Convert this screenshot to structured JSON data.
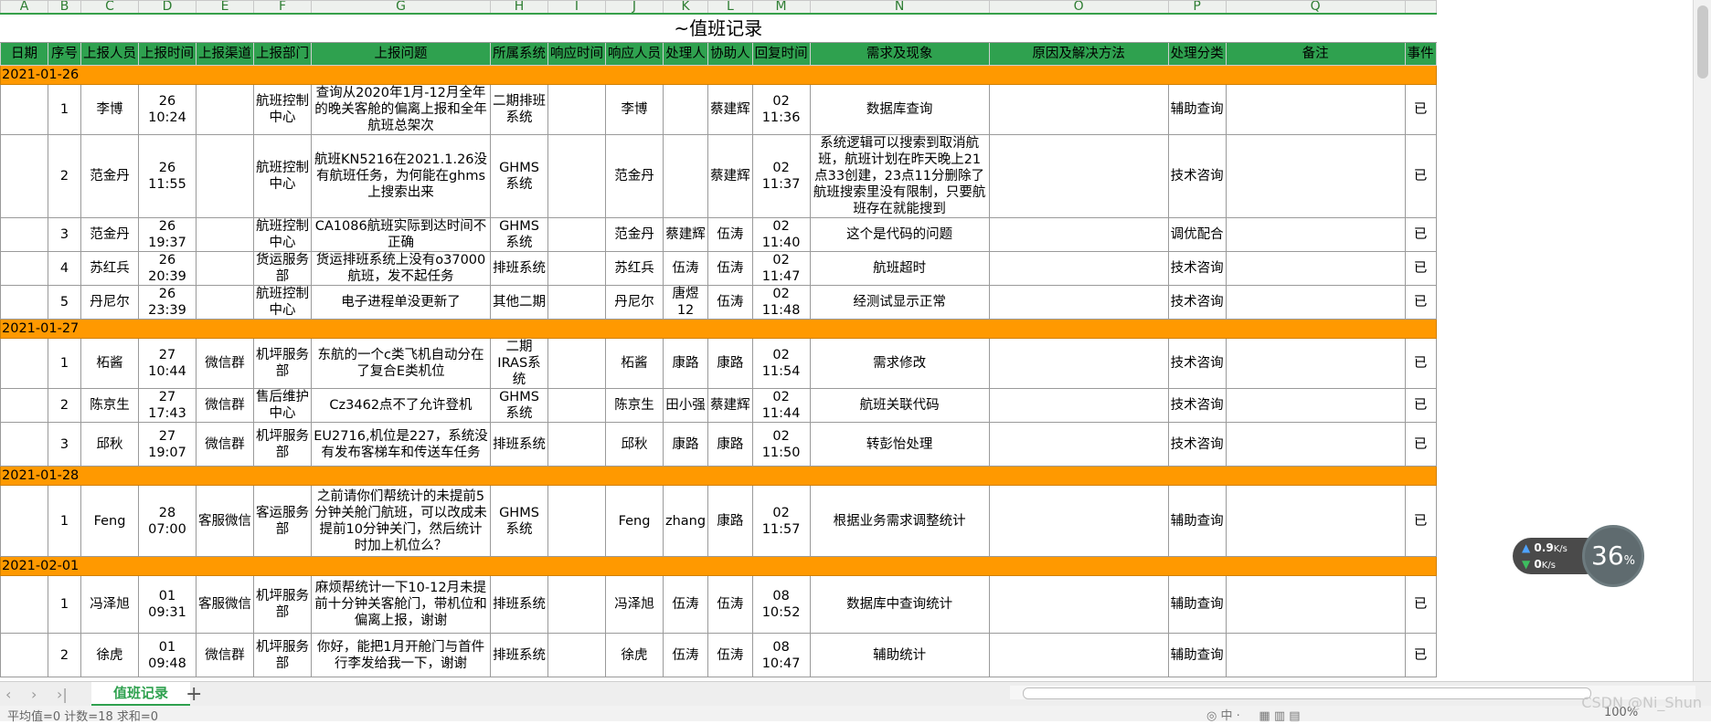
{
  "columns": [
    "A",
    "B",
    "C",
    "D",
    "E",
    "F",
    "G",
    "H",
    "I",
    "J",
    "K",
    "L",
    "M",
    "N",
    "O",
    "P",
    "Q"
  ],
  "sheet_title": "~值班记录",
  "headers": [
    "日期",
    "序号",
    "上报人员",
    "上报时间",
    "上报渠道",
    "上报部门",
    "上报问题",
    "所属系统",
    "响应时间",
    "响应人员",
    "处理人",
    "协助人",
    "回复时间",
    "需求及现象",
    "原因及解决方法",
    "处理分类",
    "备注",
    "事件"
  ],
  "groups": [
    {
      "date": "2021-01-26",
      "rows": [
        {
          "no": "1",
          "reporter": "李博",
          "time": "26 10:24",
          "channel": "",
          "dept": "航班控制中心",
          "issue": "查询从2020年1月-12月全年的晚关客舱的偏离上报和全年航班总架次",
          "system": "二期排班系统",
          "resp_time": "",
          "responder": "李博",
          "handler": "",
          "assist": "蔡建辉",
          "reply": "02 11:36",
          "phenomenon": "数据库查询",
          "cause": "",
          "category": "辅助查询",
          "remark": "",
          "event": "已",
          "h": 30
        },
        {
          "no": "2",
          "reporter": "范金丹",
          "time": "26 11:55",
          "channel": "",
          "dept": "航班控制中心",
          "issue": "航班KN5216在2021.1.26没有航班任务，为何能在ghms上搜索出来",
          "system": "GHMS系统",
          "resp_time": "",
          "responder": "范金丹",
          "handler": "",
          "assist": "蔡建辉",
          "reply": "02 11:37",
          "phenomenon": "系统逻辑可以搜索到取消航班，航班计划在昨天晚上21点33创建，23点11分删除了 航班搜索里没有限制，只要航班存在就能搜到",
          "cause": "",
          "category": "技术咨询",
          "remark": "",
          "event": "已",
          "h": 63
        },
        {
          "no": "3",
          "reporter": "范金丹",
          "time": "26 19:37",
          "channel": "",
          "dept": "航班控制中心",
          "issue": "CA1086航班实际到达时间不正确",
          "system": "GHMS系统",
          "resp_time": "",
          "responder": "范金丹",
          "handler": "蔡建辉",
          "assist": "伍涛",
          "reply": "02 11:40",
          "phenomenon": "这个是代码的问题",
          "cause": "",
          "category": "调优配合",
          "remark": "",
          "event": "已",
          "h": 30
        },
        {
          "no": "4",
          "reporter": "苏红兵",
          "time": "26 20:39",
          "channel": "",
          "dept": "货运服务部",
          "issue": "货运排班系统上没有o37000航班，发不起任务",
          "system": "排班系统",
          "resp_time": "",
          "responder": "苏红兵",
          "handler": "伍涛",
          "assist": "伍涛",
          "reply": "02 11:47",
          "phenomenon": "航班超时",
          "cause": "",
          "category": "技术咨询",
          "remark": "",
          "event": "已",
          "h": 30
        },
        {
          "no": "5",
          "reporter": "丹尼尔",
          "time": "26 23:39",
          "channel": "",
          "dept": "航班控制中心",
          "issue": "电子进程单没更新了",
          "system": "其他二期",
          "resp_time": "",
          "responder": "丹尼尔",
          "handler": "唐煜12",
          "assist": "伍涛",
          "reply": "02 11:48",
          "phenomenon": "经测试显示正常",
          "cause": "",
          "category": "技术咨询",
          "remark": "",
          "event": "已",
          "h": 30
        }
      ]
    },
    {
      "date": "2021-01-27",
      "rows": [
        {
          "no": "1",
          "reporter": "柘酱",
          "time": "27 10:44",
          "channel": "微信群",
          "dept": "机坪服务部",
          "issue": "东航的一个c类飞机自动分在了复合E类机位",
          "system": "二期IRAS系统",
          "resp_time": "",
          "responder": "柘酱",
          "handler": "康路",
          "assist": "康路",
          "reply": "02 11:54",
          "phenomenon": "需求修改",
          "cause": "",
          "category": "技术咨询",
          "remark": "",
          "event": "已",
          "h": 48
        },
        {
          "no": "2",
          "reporter": "陈京生",
          "time": "27 17:43",
          "channel": "微信群",
          "dept": "售后维护中心",
          "issue": "Cz3462点不了允许登机",
          "system": "GHMS系统",
          "resp_time": "",
          "responder": "陈京生",
          "handler": "田小强",
          "assist": "蔡建辉",
          "reply": "02 11:44",
          "phenomenon": "航班关联代码",
          "cause": "",
          "category": "技术咨询",
          "remark": "",
          "event": "已",
          "h": 30
        },
        {
          "no": "3",
          "reporter": "邱秋",
          "time": "27 19:07",
          "channel": "微信群",
          "dept": "机坪服务部",
          "issue": "EU2716,机位是227，系统没有发布客梯车和传送车任务",
          "system": "排班系统",
          "resp_time": "",
          "responder": "邱秋",
          "handler": "康路",
          "assist": "康路",
          "reply": "02 11:50",
          "phenomenon": "转彭怡处理",
          "cause": "",
          "category": "技术咨询",
          "remark": "",
          "event": "已",
          "h": 48
        }
      ]
    },
    {
      "date": "2021-01-28",
      "rows": [
        {
          "no": "1",
          "reporter": "Feng",
          "time": "28 07:00",
          "channel": "客服微信",
          "dept": "客运服务部",
          "issue": "之前请你们帮统计的未提前5分钟关舱门航班，可以改成未提前10分钟关门，然后统计时加上机位么？",
          "system": "GHMS系统",
          "resp_time": "",
          "responder": "Feng",
          "handler": "zhang",
          "assist": "康路",
          "reply": "02 11:57",
          "phenomenon": "根据业务需求调整统计",
          "cause": "",
          "category": "辅助查询",
          "remark": "",
          "event": "已",
          "h": 78
        }
      ]
    },
    {
      "date": "2021-02-01",
      "rows": [
        {
          "no": "1",
          "reporter": "冯泽旭",
          "time": "01 09:31",
          "channel": "客服微信",
          "dept": "机坪服务部",
          "issue": "麻烦帮统计一下10-12月未提前十分钟关客舱门，带机位和偏离上报，谢谢",
          "system": "排班系统",
          "resp_time": "",
          "responder": "冯泽旭",
          "handler": "伍涛",
          "assist": "伍涛",
          "reply": "08 10:52",
          "phenomenon": "数据库中查询统计",
          "cause": "",
          "category": "辅助查询",
          "remark": "",
          "event": "已",
          "h": 63
        },
        {
          "no": "2",
          "reporter": "徐虎",
          "time": "01 09:48",
          "channel": "微信群",
          "dept": "机坪服务部",
          "issue": "你好，能把1月开舱门与首件行李发给我一下，谢谢",
          "system": "排班系统",
          "resp_time": "",
          "responder": "徐虎",
          "handler": "伍涛",
          "assist": "伍涛",
          "reply": "08 10:47",
          "phenomenon": "辅助统计",
          "cause": "",
          "category": "辅助查询",
          "remark": "",
          "event": "已",
          "h": 48
        }
      ]
    }
  ],
  "tab_label": "值班记录",
  "status_text": "平均值=0  计数=18  求和=0",
  "zoom_text": "100%",
  "net": {
    "up": "0.9",
    "up_unit": "K/s",
    "down": "0",
    "down_unit": "K/s",
    "cpu": "36",
    "cpu_unit": "%"
  },
  "watermark": "CSDN @Ni_Shun"
}
